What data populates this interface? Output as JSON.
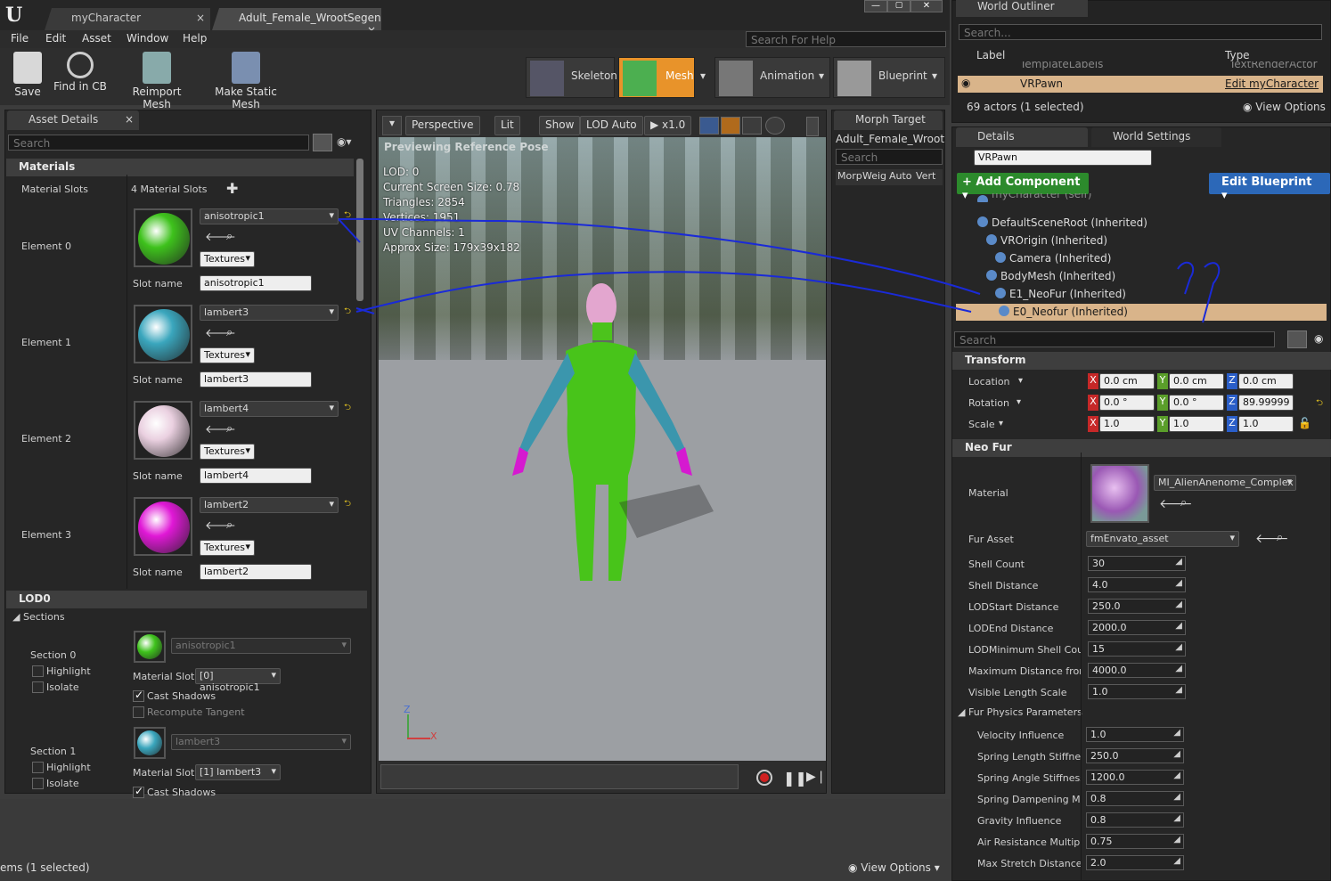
{
  "tabs": {
    "t1": "myCharacter",
    "t2": "Adult_Female_WrootSegen"
  },
  "menu": [
    "File",
    "Edit",
    "Asset",
    "Window",
    "Help"
  ],
  "help_search": "Search For Help",
  "toolbar": {
    "save": "Save",
    "find": "Find in CB",
    "reimport": "Reimport Mesh",
    "make_static": "Make Static Mesh"
  },
  "modes": {
    "skeleton": "Skeleton",
    "mesh": "Mesh",
    "animation": "Animation",
    "blueprint": "Blueprint"
  },
  "asset_details": {
    "tab": "Asset Details",
    "search": "Search",
    "materials_hdr": "Materials",
    "material_slots_label": "Material Slots",
    "slots_count": "4 Material Slots",
    "elements": [
      {
        "label": "Element 0",
        "material": "anisotropic1",
        "textures": "Textures",
        "slot_label": "Slot name",
        "slot": "anisotropic1",
        "color": "#3ec21c"
      },
      {
        "label": "Element 1",
        "material": "lambert3",
        "textures": "Textures",
        "slot_label": "Slot name",
        "slot": "lambert3",
        "color": "#3aa6bd"
      },
      {
        "label": "Element 2",
        "material": "lambert4",
        "textures": "Textures",
        "slot_label": "Slot name",
        "slot": "lambert4",
        "color": "#ead0e0"
      },
      {
        "label": "Element 3",
        "material": "lambert2",
        "textures": "Textures",
        "slot_label": "Slot name",
        "slot": "lambert2",
        "color": "#e018d6"
      }
    ],
    "lod_hdr": "LOD0",
    "sections_hdr": "Sections",
    "sections": [
      {
        "label": "Section 0",
        "highlight": "Highlight",
        "isolate": "Isolate",
        "material": "anisotropic1",
        "mat_slot_label": "Material Slot",
        "mat_slot": "[0] anisotropic1",
        "cast": "Cast Shadows",
        "recompute": "Recompute Tangent"
      },
      {
        "label": "Section 1",
        "highlight": "Highlight",
        "isolate": "Isolate",
        "material": "lambert3",
        "mat_slot_label": "Material Slot",
        "mat_slot": "[1] lambert3",
        "cast": "Cast Shadows"
      }
    ]
  },
  "viewport": {
    "perspective": "Perspective",
    "lit": "Lit",
    "show": "Show",
    "lod": "LOD Auto",
    "speed": "x1.0",
    "preview": "Previewing Reference Pose",
    "stats": [
      "LOD: 0",
      "Current Screen Size: 0.78",
      "Triangles: 2854",
      "Vertices: 1951",
      "UV Channels: 1",
      "Approx Size: 179x39x182"
    ]
  },
  "morph": {
    "tab": "Morph Target",
    "name": "Adult_Female_WrootS",
    "search": "Search",
    "cols": [
      "Morp",
      "Weig",
      "Auto",
      "Vert"
    ]
  },
  "outliner": {
    "tab": "World Outliner",
    "search": "Search...",
    "col_label": "Label",
    "col_type": "Type",
    "row_prev": "TemplateLabels",
    "row_prev_type": "TextRenderActor",
    "row_sel": "VRPawn",
    "row_sel_type": "Edit myCharacter",
    "count": "69 actors (1 selected)",
    "view_options": "View Options"
  },
  "details": {
    "tab": "Details",
    "tab2": "World Settings",
    "name": "VRPawn",
    "add": "+ Add Component",
    "edit_bp": "Edit Blueprint",
    "tree": [
      "myCharacter (self)",
      "DefaultSceneRoot (Inherited)",
      "VROrigin (Inherited)",
      "Camera (Inherited)",
      "BodyMesh (Inherited)",
      "E1_NeoFur (Inherited)",
      "E0_Neofur (Inherited)"
    ],
    "search": "Search",
    "transform_hdr": "Transform",
    "location_label": "Location",
    "rotation_label": "Rotation",
    "scale_label": "Scale",
    "location": [
      "0.0 cm",
      "0.0 cm",
      "0.0 cm"
    ],
    "rotation": [
      "0.0 °",
      "0.0 °",
      "89.99999"
    ],
    "scale": [
      "1.0",
      "1.0",
      "1.0"
    ],
    "neofur_hdr": "Neo Fur",
    "material_label": "Material",
    "material": "MI_AlienAnenome_Complex",
    "fur_asset_label": "Fur Asset",
    "fur_asset": "fmEnvato_asset",
    "props": [
      [
        "Shell Count",
        "30"
      ],
      [
        "Shell Distance",
        "4.0"
      ],
      [
        "LODStart Distance",
        "250.0"
      ],
      [
        "LODEnd Distance",
        "2000.0"
      ],
      [
        "LODMinimum Shell Count",
        "15"
      ],
      [
        "Maximum Distance from",
        "4000.0"
      ],
      [
        "Visible Length Scale",
        "1.0"
      ]
    ],
    "physics_hdr": "Fur Physics Parameters",
    "physics": [
      [
        "Velocity Influence",
        "1.0"
      ],
      [
        "Spring Length Stiffness",
        "250.0"
      ],
      [
        "Spring Angle Stiffness",
        "1200.0"
      ],
      [
        "Spring Dampening Mult",
        "0.8"
      ],
      [
        "Gravity Influence",
        "0.8"
      ],
      [
        "Air Resistance Multiplie",
        "0.75"
      ],
      [
        "Max Stretch Distance M",
        "2.0"
      ]
    ]
  },
  "bottom": {
    "items": "ems (1 selected)",
    "view_options": "View Options"
  },
  "annotation": "??"
}
